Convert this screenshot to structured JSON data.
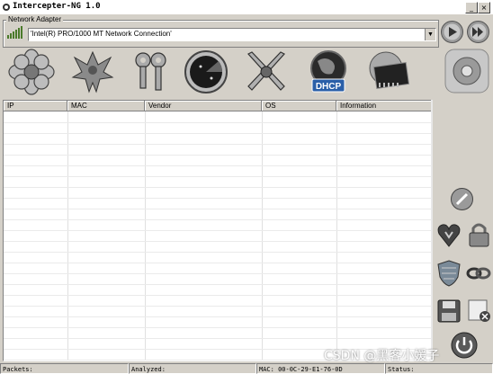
{
  "window": {
    "title": "Intercepter-NG 1.0",
    "controls": [
      "_",
      "□",
      "×"
    ]
  },
  "adapter": {
    "group_label": "Network Adapter",
    "selected": "'Intel(R) PRO/1000 MT Network Connection'"
  },
  "toolbar": {
    "items": [
      "flower-icon",
      "phoenix-icon",
      "keys-icon",
      "radar-icon",
      "crossed-swords-icon",
      "dhcp-globe-icon",
      "network-card-icon"
    ],
    "dhcp_label": "DHCP"
  },
  "table": {
    "columns": [
      "IP",
      "MAC",
      "Vendor",
      "OS",
      "Information"
    ]
  },
  "status": {
    "packets": "Packets:",
    "analyzed": "Analyzed:",
    "mac": "MAC: 00-0C-29-E1-76-0D",
    "status": "Status:"
  },
  "watermark": "CSDN @黑客小媛子",
  "colors": {
    "face": "#d4d0c8",
    "accent_blue": "#2a5fa8"
  }
}
